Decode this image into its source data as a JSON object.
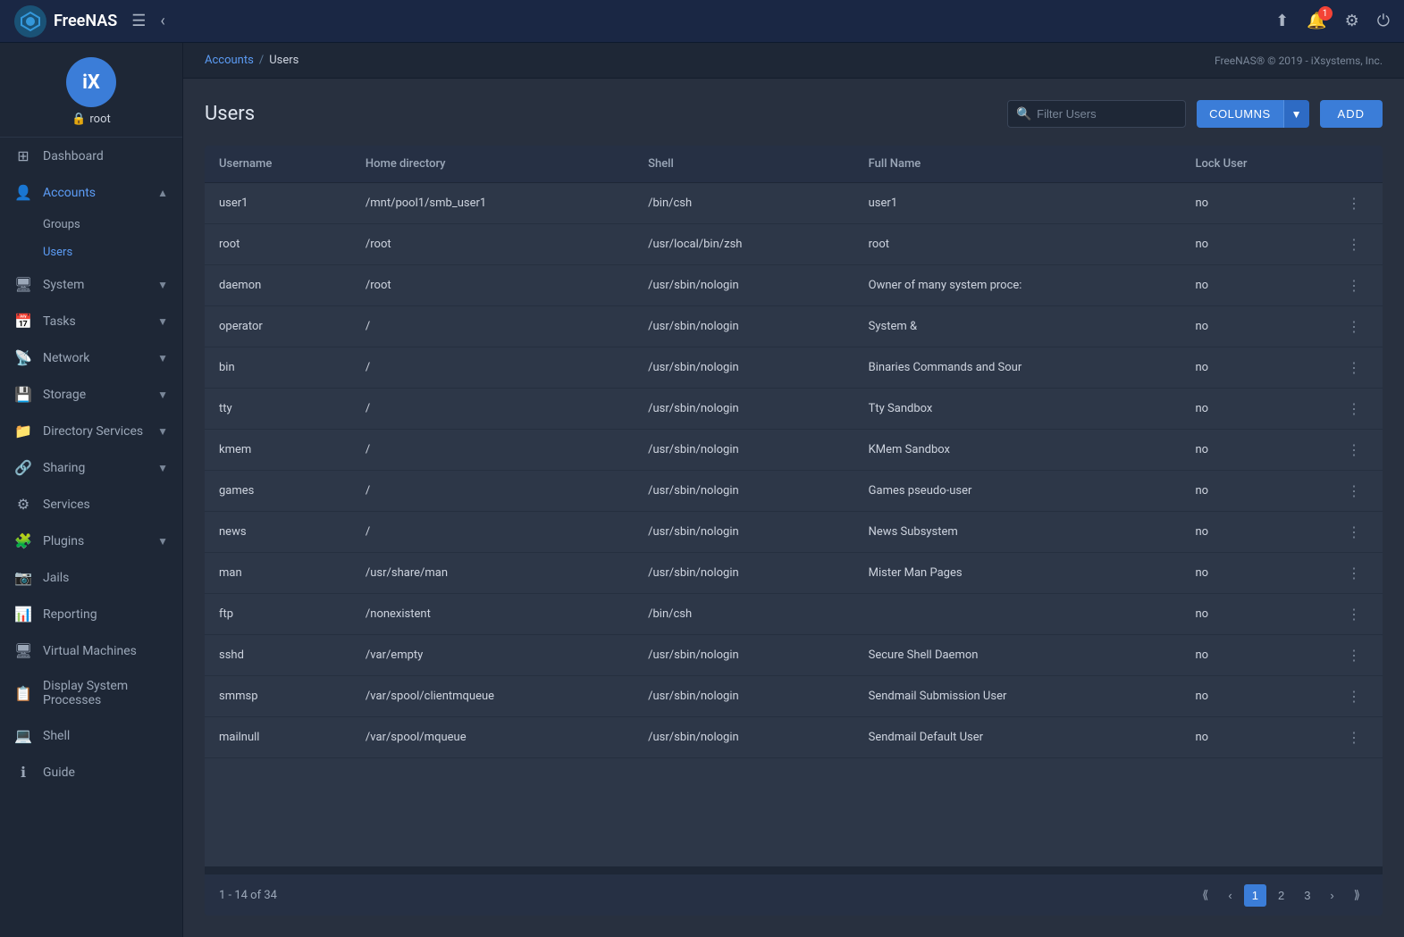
{
  "app": {
    "name": "FreeNAS",
    "copyright": "FreeNAS® © 2019 - iXsystems, Inc."
  },
  "header": {
    "menu_icon": "☰",
    "back_icon": "‹"
  },
  "topbar_icons": {
    "upload": "⬆",
    "notification": "🔔",
    "notification_count": "1",
    "settings": "⚙",
    "power": "⏻"
  },
  "user": {
    "avatar_letter": "iX",
    "name": "root",
    "lock_icon": "🔒"
  },
  "sidebar": {
    "items": [
      {
        "id": "dashboard",
        "label": "Dashboard",
        "icon": "⊞",
        "expandable": false
      },
      {
        "id": "accounts",
        "label": "Accounts",
        "icon": "👤",
        "expandable": true,
        "expanded": true,
        "active": true
      },
      {
        "id": "system",
        "label": "System",
        "icon": "🖥",
        "expandable": true
      },
      {
        "id": "tasks",
        "label": "Tasks",
        "icon": "📅",
        "expandable": true
      },
      {
        "id": "network",
        "label": "Network",
        "icon": "📡",
        "expandable": true
      },
      {
        "id": "storage",
        "label": "Storage",
        "icon": "💾",
        "expandable": true
      },
      {
        "id": "directory-services",
        "label": "Directory Services",
        "icon": "📁",
        "expandable": true
      },
      {
        "id": "sharing",
        "label": "Sharing",
        "icon": "🔗",
        "expandable": true
      },
      {
        "id": "services",
        "label": "Services",
        "icon": "⚙",
        "expandable": false
      },
      {
        "id": "plugins",
        "label": "Plugins",
        "icon": "🧩",
        "expandable": true
      },
      {
        "id": "jails",
        "label": "Jails",
        "icon": "📷",
        "expandable": false
      },
      {
        "id": "reporting",
        "label": "Reporting",
        "icon": "📊",
        "expandable": false
      },
      {
        "id": "virtual-machines",
        "label": "Virtual Machines",
        "icon": "🖥",
        "expandable": false
      },
      {
        "id": "display-system-processes",
        "label": "Display System Processes",
        "icon": "📋",
        "expandable": false
      },
      {
        "id": "shell",
        "label": "Shell",
        "icon": "💻",
        "expandable": false
      },
      {
        "id": "guide",
        "label": "Guide",
        "icon": "ℹ",
        "expandable": false
      }
    ],
    "sub_items": [
      {
        "id": "groups",
        "label": "Groups"
      },
      {
        "id": "users",
        "label": "Users",
        "active": true
      }
    ]
  },
  "breadcrumb": {
    "parent": "Accounts",
    "separator": "/",
    "current": "Users",
    "copyright": "FreeNAS® © 2019 - iXsystems, Inc."
  },
  "page": {
    "title": "Users",
    "filter_placeholder": "Filter Users",
    "columns_label": "COLUMNS",
    "add_label": "ADD"
  },
  "table": {
    "columns": [
      {
        "id": "username",
        "label": "Username"
      },
      {
        "id": "home_directory",
        "label": "Home directory"
      },
      {
        "id": "shell",
        "label": "Shell"
      },
      {
        "id": "full_name",
        "label": "Full Name"
      },
      {
        "id": "lock_user",
        "label": "Lock User"
      }
    ],
    "rows": [
      {
        "username": "user1",
        "home_directory": "/mnt/pool1/smb_user1",
        "shell": "/bin/csh",
        "full_name": "user1",
        "lock_user": "no"
      },
      {
        "username": "root",
        "home_directory": "/root",
        "shell": "/usr/local/bin/zsh",
        "full_name": "root",
        "lock_user": "no"
      },
      {
        "username": "daemon",
        "home_directory": "/root",
        "shell": "/usr/sbin/nologin",
        "full_name": "Owner of many system proce:",
        "lock_user": "no"
      },
      {
        "username": "operator",
        "home_directory": "/",
        "shell": "/usr/sbin/nologin",
        "full_name": "System &",
        "lock_user": "no"
      },
      {
        "username": "bin",
        "home_directory": "/",
        "shell": "/usr/sbin/nologin",
        "full_name": "Binaries Commands and Sour",
        "lock_user": "no"
      },
      {
        "username": "tty",
        "home_directory": "/",
        "shell": "/usr/sbin/nologin",
        "full_name": "Tty Sandbox",
        "lock_user": "no"
      },
      {
        "username": "kmem",
        "home_directory": "/",
        "shell": "/usr/sbin/nologin",
        "full_name": "KMem Sandbox",
        "lock_user": "no"
      },
      {
        "username": "games",
        "home_directory": "/",
        "shell": "/usr/sbin/nologin",
        "full_name": "Games pseudo-user",
        "lock_user": "no"
      },
      {
        "username": "news",
        "home_directory": "/",
        "shell": "/usr/sbin/nologin",
        "full_name": "News Subsystem",
        "lock_user": "no"
      },
      {
        "username": "man",
        "home_directory": "/usr/share/man",
        "shell": "/usr/sbin/nologin",
        "full_name": "Mister Man Pages",
        "lock_user": "no"
      },
      {
        "username": "ftp",
        "home_directory": "/nonexistent",
        "shell": "/bin/csh",
        "full_name": "",
        "lock_user": "no"
      },
      {
        "username": "sshd",
        "home_directory": "/var/empty",
        "shell": "/usr/sbin/nologin",
        "full_name": "Secure Shell Daemon",
        "lock_user": "no"
      },
      {
        "username": "smmsp",
        "home_directory": "/var/spool/clientmqueue",
        "shell": "/usr/sbin/nologin",
        "full_name": "Sendmail Submission User",
        "lock_user": "no"
      },
      {
        "username": "mailnull",
        "home_directory": "/var/spool/mqueue",
        "shell": "/usr/sbin/nologin",
        "full_name": "Sendmail Default User",
        "lock_user": "no"
      }
    ]
  },
  "pagination": {
    "info": "1 - 14 of 34",
    "current_page": 1,
    "pages": [
      "1",
      "2",
      "3"
    ]
  }
}
